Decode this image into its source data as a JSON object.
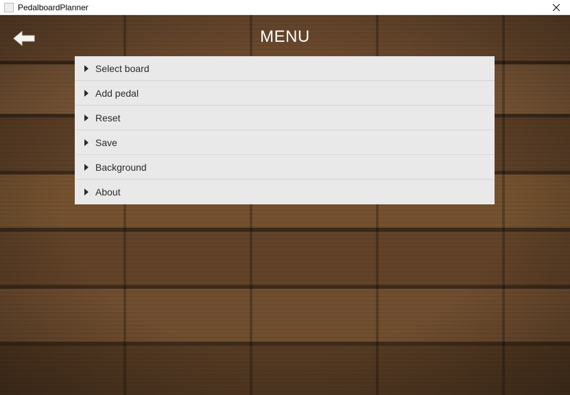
{
  "window": {
    "title": "PedalboardPlanner"
  },
  "header": {
    "title": "MENU"
  },
  "menu": {
    "items": [
      {
        "label": "Select board"
      },
      {
        "label": "Add pedal"
      },
      {
        "label": "Reset"
      },
      {
        "label": "Save"
      },
      {
        "label": "Background"
      },
      {
        "label": "About"
      }
    ]
  }
}
